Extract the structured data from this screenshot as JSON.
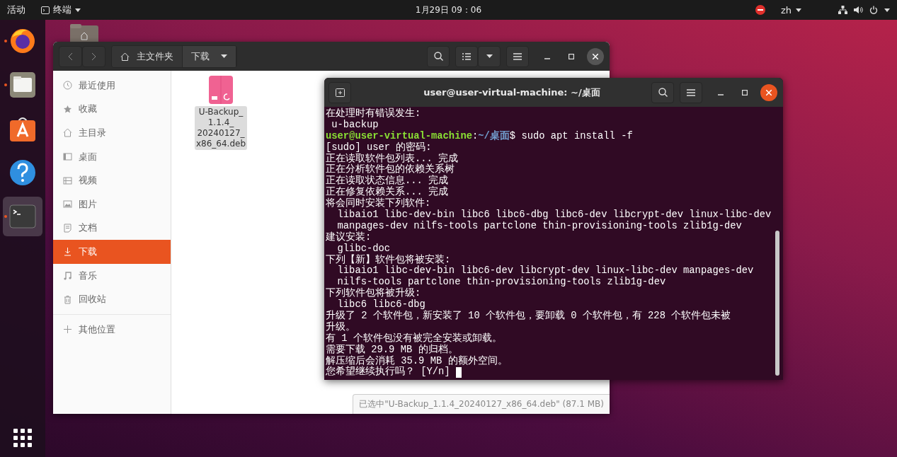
{
  "top_bar": {
    "activities": "活动",
    "app_menu": "终端",
    "clock": "1月29日 09：06",
    "language": "zh"
  },
  "dock": {
    "items": [
      {
        "kind": "firefox",
        "running": true,
        "selected": false
      },
      {
        "kind": "files",
        "running": true,
        "selected": false
      },
      {
        "kind": "software",
        "running": false,
        "selected": false
      },
      {
        "kind": "help",
        "running": false,
        "selected": false
      },
      {
        "kind": "terminal",
        "running": true,
        "selected": true
      }
    ]
  },
  "files_window": {
    "path": [
      {
        "label": "主文件夹",
        "kind": "home",
        "selected": false
      },
      {
        "label": "下载",
        "kind": "folder",
        "selected": true
      }
    ],
    "sidebar": {
      "items": [
        {
          "label": "最近使用",
          "kind": "recent",
          "selected": false
        },
        {
          "label": "收藏",
          "kind": "star",
          "selected": false
        },
        {
          "label": "主目录",
          "kind": "home",
          "selected": false
        },
        {
          "label": "桌面",
          "kind": "desktop",
          "selected": false
        },
        {
          "label": "视频",
          "kind": "video",
          "selected": false
        },
        {
          "label": "图片",
          "kind": "picture",
          "selected": false
        },
        {
          "label": "文档",
          "kind": "document",
          "selected": false
        },
        {
          "label": "下载",
          "kind": "download",
          "selected": true
        },
        {
          "label": "音乐",
          "kind": "music",
          "selected": false
        },
        {
          "label": "回收站",
          "kind": "trash",
          "selected": false
        }
      ],
      "other": {
        "label": "其他位置"
      }
    },
    "files": [
      {
        "label_lines": [
          "U-Backup_",
          "1.1.4_",
          "20240127_",
          "x86_64.deb"
        ],
        "selected": true
      }
    ],
    "status": "已选中\"U-Backup_1.1.4_20240127_x86_64.deb\" (87.1 MB)"
  },
  "terminal_window": {
    "title": "user@user-virtual-machine: ~/桌面",
    "lines": [
      {
        "kind": "text",
        "text": "在处理时有错误发生:"
      },
      {
        "kind": "text",
        "text": " u-backup"
      },
      {
        "kind": "prompt",
        "user": "user@user-virtual-machine",
        "sep": ":",
        "path": "~/桌面",
        "symbol": "$",
        "command": " sudo apt install -f"
      },
      {
        "kind": "text",
        "text": "[sudo] user 的密码:"
      },
      {
        "kind": "text",
        "text": "正在读取软件包列表... 完成"
      },
      {
        "kind": "text",
        "text": "正在分析软件包的依赖关系树"
      },
      {
        "kind": "text",
        "text": "正在读取状态信息... 完成"
      },
      {
        "kind": "text",
        "text": "正在修复依赖关系... 完成"
      },
      {
        "kind": "text",
        "text": "将会同时安装下列软件:"
      },
      {
        "kind": "text",
        "text": "  libaio1 libc-dev-bin libc6 libc6-dbg libc6-dev libcrypt-dev linux-libc-dev"
      },
      {
        "kind": "text",
        "text": "  manpages-dev nilfs-tools partclone thin-provisioning-tools zlib1g-dev"
      },
      {
        "kind": "text",
        "text": "建议安装:"
      },
      {
        "kind": "text",
        "text": "  glibc-doc"
      },
      {
        "kind": "text",
        "text": "下列【新】软件包将被安装:"
      },
      {
        "kind": "text",
        "text": "  libaio1 libc-dev-bin libc6-dev libcrypt-dev linux-libc-dev manpages-dev"
      },
      {
        "kind": "text",
        "text": "  nilfs-tools partclone thin-provisioning-tools zlib1g-dev"
      },
      {
        "kind": "text",
        "text": "下列软件包将被升级:"
      },
      {
        "kind": "text",
        "text": "  libc6 libc6-dbg"
      },
      {
        "kind": "text",
        "text": "升级了 2 个软件包，新安装了 10 个软件包，要卸载 0 个软件包，有 228 个软件包未被"
      },
      {
        "kind": "text",
        "text": "升级。"
      },
      {
        "kind": "text",
        "text": "有 1 个软件包没有被完全安装或卸载。"
      },
      {
        "kind": "text",
        "text": "需要下载 29.9 MB 的归档。"
      },
      {
        "kind": "text",
        "text": "解压缩后会消耗 35.9 MB 的额外空间。"
      },
      {
        "kind": "input",
        "text": "您希望继续执行吗？ [Y/n] ",
        "cursor": true
      }
    ]
  }
}
